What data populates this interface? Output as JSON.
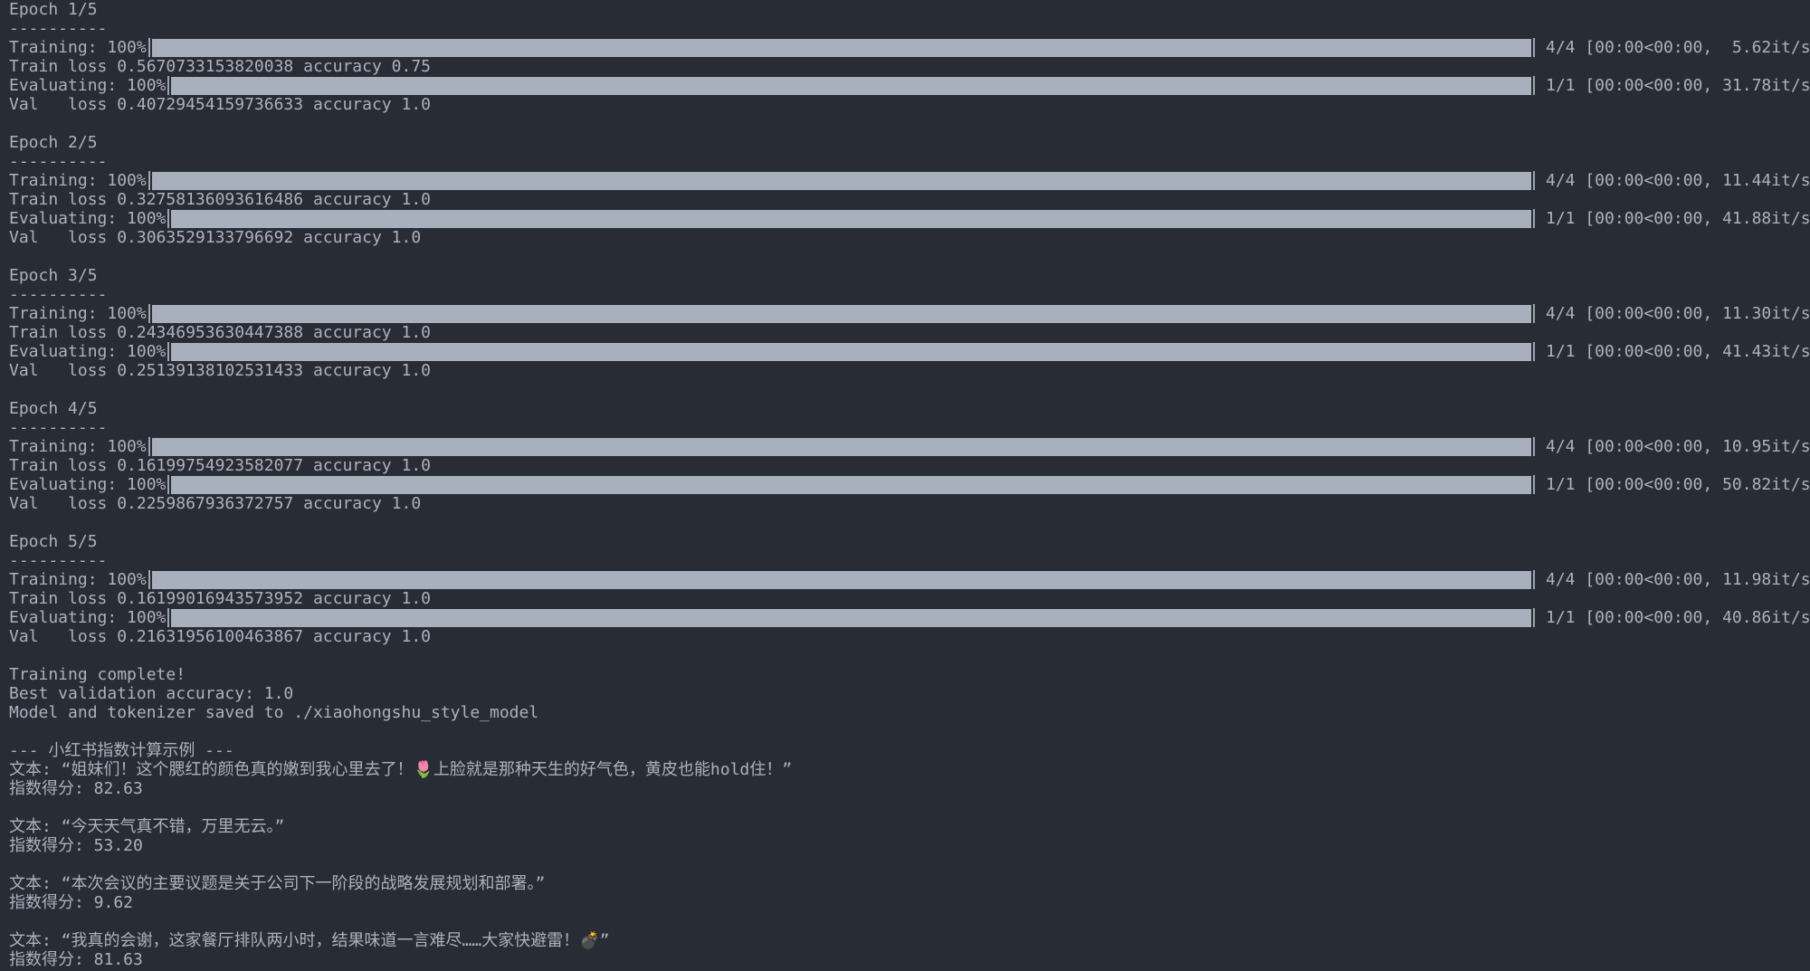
{
  "epochs": [
    {
      "header": "Epoch 1/5",
      "separator": "----------",
      "training": {
        "label": "Training: 100%",
        "stats": "4/4 [00:00<00:00,  5.62it/s]",
        "progress": 1.0
      },
      "train_line": "Train loss 0.5670733153820038 accuracy 0.75",
      "evaluating": {
        "label": "Evaluating: 100%",
        "stats": "1/1 [00:00<00:00, 31.78it/s]",
        "progress": 1.0
      },
      "val_line": "Val   loss 0.40729454159736633 accuracy 1.0"
    },
    {
      "header": "Epoch 2/5",
      "separator": "----------",
      "training": {
        "label": "Training: 100%",
        "stats": "4/4 [00:00<00:00, 11.44it/s]",
        "progress": 1.0
      },
      "train_line": "Train loss 0.32758136093616486 accuracy 1.0",
      "evaluating": {
        "label": "Evaluating: 100%",
        "stats": "1/1 [00:00<00:00, 41.88it/s]",
        "progress": 1.0
      },
      "val_line": "Val   loss 0.3063529133796692 accuracy 1.0"
    },
    {
      "header": "Epoch 3/5",
      "separator": "----------",
      "training": {
        "label": "Training: 100%",
        "stats": "4/4 [00:00<00:00, 11.30it/s]",
        "progress": 1.0
      },
      "train_line": "Train loss 0.24346953630447388 accuracy 1.0",
      "evaluating": {
        "label": "Evaluating: 100%",
        "stats": "1/1 [00:00<00:00, 41.43it/s]",
        "progress": 1.0
      },
      "val_line": "Val   loss 0.25139138102531433 accuracy 1.0"
    },
    {
      "header": "Epoch 4/5",
      "separator": "----------",
      "training": {
        "label": "Training: 100%",
        "stats": "4/4 [00:00<00:00, 10.95it/s]",
        "progress": 1.0
      },
      "train_line": "Train loss 0.16199754923582077 accuracy 1.0",
      "evaluating": {
        "label": "Evaluating: 100%",
        "stats": "1/1 [00:00<00:00, 50.82it/s]",
        "progress": 1.0
      },
      "val_line": "Val   loss 0.2259867936372757 accuracy 1.0"
    },
    {
      "header": "Epoch 5/5",
      "separator": "----------",
      "training": {
        "label": "Training: 100%",
        "stats": "4/4 [00:00<00:00, 11.98it/s]",
        "progress": 1.0
      },
      "train_line": "Train loss 0.16199016943573952 accuracy 1.0",
      "evaluating": {
        "label": "Evaluating: 100%",
        "stats": "1/1 [00:00<00:00, 40.86it/s]",
        "progress": 1.0
      },
      "val_line": "Val   loss 0.21631956100463867 accuracy 1.0"
    }
  ],
  "summary": {
    "complete": "Training complete!",
    "best": "Best validation accuracy: 1.0",
    "saved": "Model and tokenizer saved to ./xiaohongshu_style_model"
  },
  "examples": {
    "header": "--- 小红书指数计算示例 ---",
    "items": [
      {
        "text": "文本: “姐妹们！这个腮红的颜色真的嫩到我心里去了！🌷上脸就是那种天生的好气色，黄皮也能hold住！”",
        "score": "指数得分: 82.63"
      },
      {
        "text": "文本: “今天天气真不错，万里无云。”",
        "score": "指数得分: 53.20"
      },
      {
        "text": "文本: “本次会议的主要议题是关于公司下一阶段的战略发展规划和部署。”",
        "score": "指数得分: 9.62"
      },
      {
        "text": "文本: “我真的会谢，这家餐厅排队两小时，结果味道一言难尽……大家快避雷！💣”",
        "score": "指数得分: 81.63"
      }
    ]
  },
  "colors": {
    "background": "#282c34",
    "text": "#abb2bf",
    "bar": "#a8b0bd"
  }
}
